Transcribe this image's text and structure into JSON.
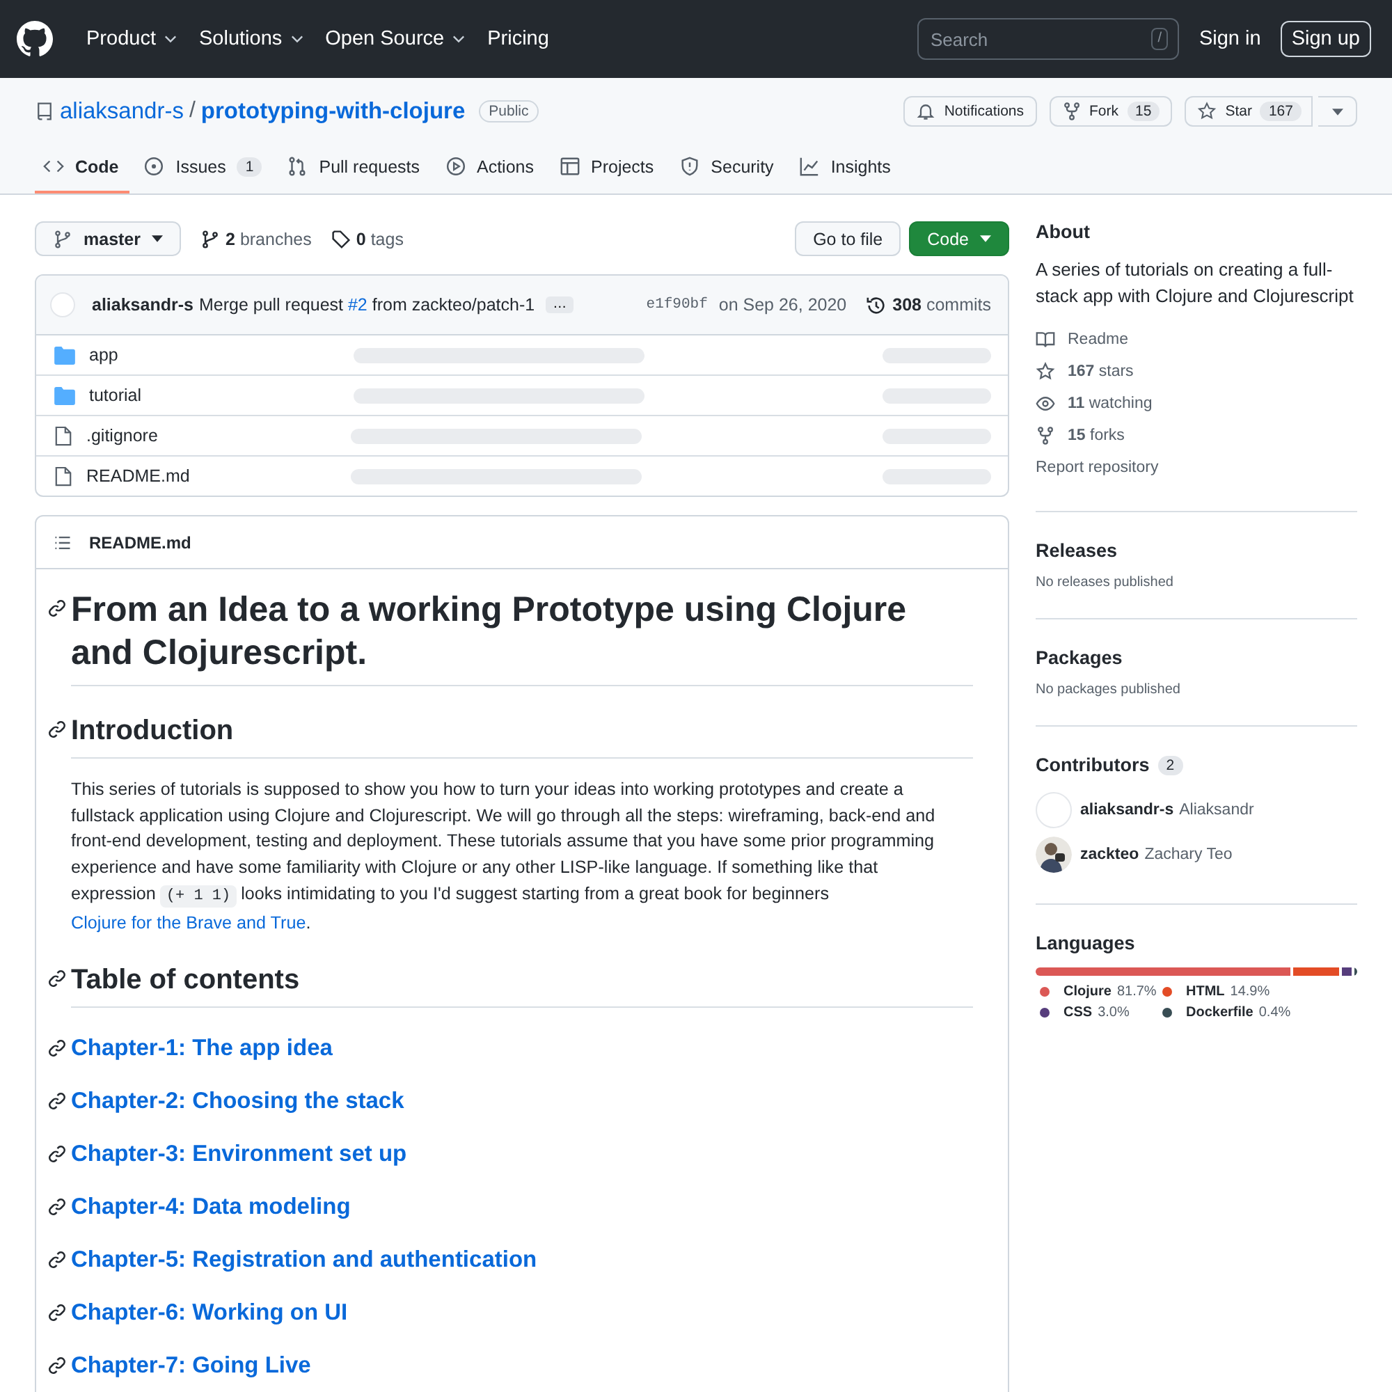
{
  "header": {
    "nav": [
      {
        "label": "Product",
        "caret": true
      },
      {
        "label": "Solutions",
        "caret": true
      },
      {
        "label": "Open Source",
        "caret": true
      },
      {
        "label": "Pricing",
        "caret": false
      }
    ],
    "search": {
      "placeholder": "Search",
      "shortcut": "/"
    },
    "sign_in": "Sign in",
    "sign_up": "Sign up"
  },
  "repo": {
    "owner": "aliaksandr-s",
    "separator": "/",
    "name": "prototyping-with-clojure",
    "visibility": "Public",
    "actions": [
      {
        "kind": "notifications",
        "label": "Notifications"
      },
      {
        "kind": "fork",
        "label": "Fork",
        "count": "15"
      },
      {
        "kind": "star",
        "label": "Star",
        "count": "167"
      }
    ]
  },
  "tabs": [
    {
      "label": "Code",
      "selected": true
    },
    {
      "label": "Issues",
      "count": "1",
      "selected": false
    },
    {
      "label": "Pull requests",
      "selected": false
    },
    {
      "label": "Actions",
      "selected": false
    },
    {
      "label": "Projects",
      "selected": false
    },
    {
      "label": "Security",
      "selected": false
    },
    {
      "label": "Insights",
      "selected": false
    }
  ],
  "toolbar": {
    "branch": "master",
    "branches_count": "2",
    "branches_label": "branches",
    "tags_count": "0",
    "tags_label": "tags",
    "go_to_file": "Go to file",
    "code_button": "Code"
  },
  "commit": {
    "author": "aliaksandr-s",
    "message_before": "Merge pull request",
    "pr": "#2",
    "message_after": "from zackteo/patch-1",
    "more": "…",
    "sha": "e1f90bf",
    "date": "on Sep 26, 2020",
    "count": "308",
    "count_label": "commits"
  },
  "files": [
    {
      "kind": "folder",
      "name": "app"
    },
    {
      "kind": "folder",
      "name": "tutorial"
    },
    {
      "kind": "file",
      "name": ".gitignore"
    },
    {
      "kind": "file",
      "name": "README.md"
    }
  ],
  "readme": {
    "filename": "README.md",
    "title": "From an Idea to a working Prototype using Clojure and Clojurescript.",
    "intro_heading": "Introduction",
    "intro": [
      {
        "kind": "text",
        "text": "This series of tutorials is supposed to show you how to turn your ideas into working prototypes and create a fullstack application using Clojure and Clojurescript. We will go through all the steps: wireframing, back-end and front-end development, testing and deployment. These tutorials assume that you have some prior programming experience and have some familiarity with Clojure or any other LISP-like language. If something like that expression "
      },
      {
        "kind": "code",
        "text": "(+ 1 1)"
      },
      {
        "kind": "text",
        "text": " looks intimidating to you I'd suggest starting from a great book for beginners "
      },
      {
        "kind": "link",
        "text": "Clojure for the Brave and True"
      },
      {
        "kind": "text",
        "text": "."
      }
    ],
    "toc_heading": "Table of contents",
    "chapters": [
      "Chapter-1: The app idea",
      "Chapter-2: Choosing the stack",
      "Chapter-3: Environment set up",
      "Chapter-4: Data modeling",
      "Chapter-5: Registration and authentication",
      "Chapter-6: Working on UI",
      "Chapter-7: Going Live"
    ]
  },
  "about": {
    "heading": "About",
    "description": "A series of tutorials on creating a full-stack app with Clojure and Clojurescript",
    "links": [
      {
        "text": "Readme"
      },
      {
        "count": "167",
        "text": "stars"
      },
      {
        "count": "11",
        "text": "watching"
      },
      {
        "count": "15",
        "text": "forks"
      }
    ],
    "report": "Report repository"
  },
  "releases": {
    "heading": "Releases",
    "text": "No releases published"
  },
  "packages": {
    "heading": "Packages",
    "text": "No packages published"
  },
  "contributors": {
    "heading": "Contributors",
    "count": "2",
    "people": [
      {
        "login": "aliaksandr-s",
        "name": "Aliaksandr"
      },
      {
        "login": "zackteo",
        "name": "Zachary Teo"
      }
    ]
  },
  "languages": {
    "heading": "Languages",
    "items": [
      {
        "name": "Clojure",
        "percent": "81.7%",
        "color": "#db5855"
      },
      {
        "name": "HTML",
        "percent": "14.9%",
        "color": "#e34c26"
      },
      {
        "name": "CSS",
        "percent": "3.0%",
        "color": "#563d7c"
      },
      {
        "name": "Dockerfile",
        "percent": "0.4%",
        "color": "#384d54"
      }
    ]
  }
}
